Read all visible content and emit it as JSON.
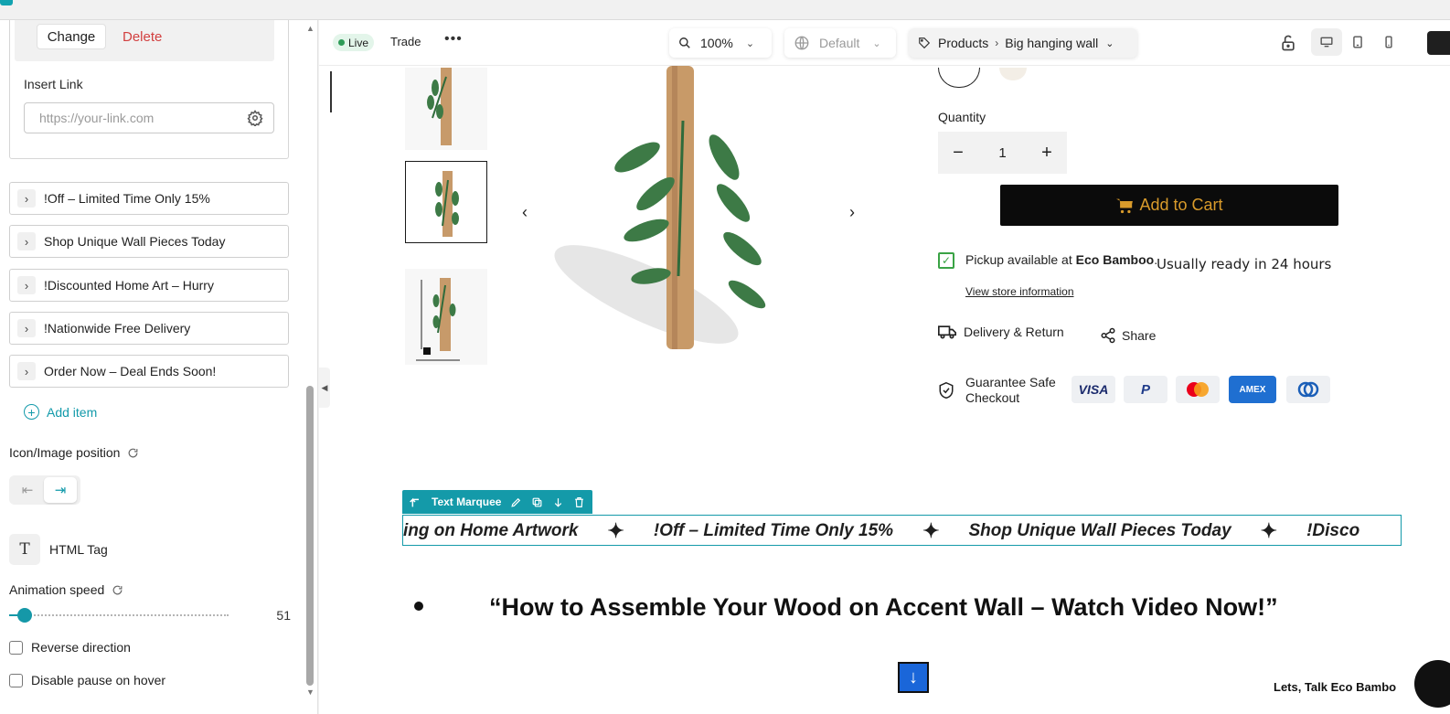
{
  "panel": {
    "change_label": "Change",
    "delete_label": "Delete",
    "insert_link_label": "Insert Link",
    "link_placeholder": "https://your-link.com",
    "items": [
      {
        "label": "!Off – Limited Time Only 15%"
      },
      {
        "label": "Shop Unique Wall Pieces Today"
      },
      {
        "label": "!Discounted Home Art – Hurry"
      },
      {
        "label": "!Nationwide Free Delivery"
      },
      {
        "label": "Order Now – Deal Ends Soon!"
      }
    ],
    "add_item_label": "Add item",
    "icon_position_label": "Icon/Image position",
    "html_tag_label": "HTML Tag",
    "animation_speed_label": "Animation speed",
    "animation_speed_value": "51",
    "animation_speed_fraction": 0.05,
    "reverse_direction_label": "Reverse direction",
    "disable_pause_label": "Disable pause on hover"
  },
  "toolbar": {
    "live_label": "Live",
    "trade_label": "Trade",
    "zoom_value": "100%",
    "locale_value": "Default",
    "breadcrumb_root": "Products",
    "breadcrumb_page": "Big hanging wall"
  },
  "product": {
    "quantity_label": "Quantity",
    "quantity_value": "1",
    "add_to_cart_label": "Add to Cart",
    "pickup_prefix": "Pickup available at ",
    "pickup_store": "Eco Bamboo",
    "pickup_suffix": ".",
    "ready_text": "Usually ready in 24 hours",
    "view_store_label": "View store information",
    "delivery_label": "Delivery & Return",
    "share_label": "Share",
    "guarantee_line1": "Guarantee Safe",
    "guarantee_line2": "Checkout",
    "payments": [
      "VISA",
      "P",
      "",
      "AMEX",
      ""
    ]
  },
  "marquee": {
    "toolbar_label": "Text Marquee",
    "texts": [
      "ing on Home Artwork",
      "!Off – Limited Time Only 15%",
      "Shop Unique Wall Pieces Today",
      "!Disco"
    ]
  },
  "content": {
    "headline": "“How to Assemble Your Wood on Accent Wall – Watch Video Now!”",
    "chat_label": "Lets, Talk Eco Bambo"
  },
  "colors": {
    "accent": "#149aa9",
    "cart_text": "#d99b2b",
    "delete": "#d23f3f",
    "live_dot": "#2e9b57"
  }
}
